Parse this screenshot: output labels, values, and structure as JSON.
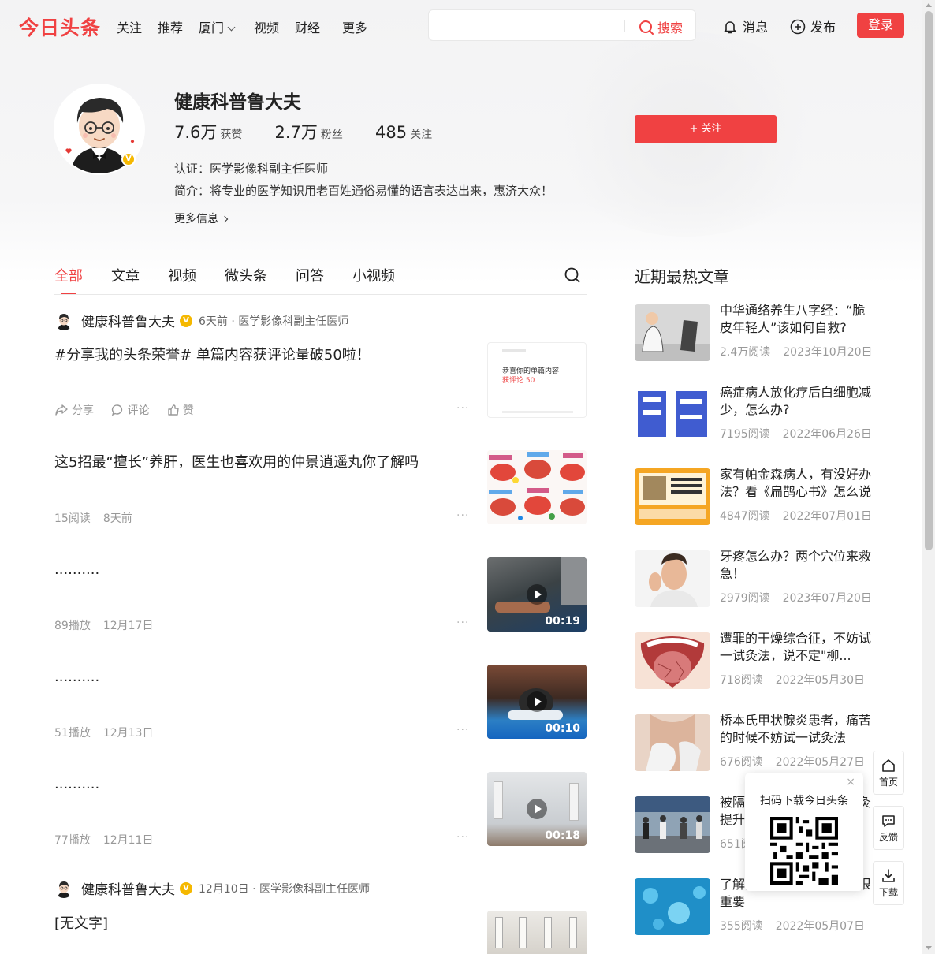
{
  "nav": {
    "logo": "今日头条",
    "links": [
      "关注",
      "推荐",
      "厦门",
      "视频",
      "财经",
      "更多"
    ],
    "search_label": "搜索",
    "messages_label": "消息",
    "publish_label": "发布",
    "login_label": "登录"
  },
  "profile": {
    "name": "健康科普鲁大夫",
    "likes_num": "7.6万",
    "likes_label": "获赞",
    "fans_num": "2.7万",
    "fans_label": "粉丝",
    "follow_num": "485",
    "follow_label": "关注",
    "cert": "认证：医学影像科副主任医师",
    "intro": "简介：将专业的医学知识用老百姓通俗易懂的语言表达出来，惠济大众！",
    "more_info": "更多信息",
    "follow_button": "+ 关注",
    "verify_mark": "V"
  },
  "tabs": [
    "全部",
    "文章",
    "视频",
    "微头条",
    "问答",
    "小视频"
  ],
  "feed": [
    {
      "author": "健康科普鲁大夫",
      "meta": "6天前 · 医学影像科副主任医师",
      "title": "#分享我的头条荣誉# 单篇内容获评论量破50啦！",
      "share": "分享",
      "comment": "评论",
      "like": "赞",
      "thumb_text1": "恭喜你的单篇内容",
      "thumb_text2": "获评论 50"
    },
    {
      "title": "这5招最“擅长”养肝，医生也喜欢用的仲景逍遥丸你了解吗",
      "reads": "15阅读",
      "time": "8天前"
    },
    {
      "title": "..........",
      "plays": "89播放",
      "time": "12月17日",
      "duration": "00:19"
    },
    {
      "title": "..........",
      "plays": "51播放",
      "time": "12月13日",
      "duration": "00:10"
    },
    {
      "title": "..........",
      "plays": "77播放",
      "time": "12月11日",
      "duration": "00:18"
    },
    {
      "author": "健康科普鲁大夫",
      "meta": "12月10日 · 医学影像科副主任医师",
      "title": "[无文字]"
    }
  ],
  "more_dots": "···",
  "hot": {
    "title": "近期最热文章",
    "items": [
      {
        "title": "中华通络养生八字经：“脆皮年轻人”该如何自救?",
        "reads": "2.4万阅读",
        "date": "2023年10月20日"
      },
      {
        "title": "癌症病人放化疗后白细胞减少，怎么办?",
        "reads": "7195阅读",
        "date": "2022年06月26日"
      },
      {
        "title": "家有帕金森病人，有没好办法？看《扁鹊心书》怎么说",
        "reads": "4847阅读",
        "date": "2022年07月01日"
      },
      {
        "title": "牙疼怎么办？两个穴位来救急！",
        "reads": "2979阅读",
        "date": "2023年07月20日"
      },
      {
        "title": "遭罪的干燥综合征，不妨试一试灸法，说不定\"柳...",
        "reads": "718阅读",
        "date": "2022年05月30日"
      },
      {
        "title": "桥本氏甲状腺炎患者，痛苦的时候不妨试一试灸法",
        "reads": "676阅读",
        "date": "2022年05月27日"
      },
      {
        "title": "被隔离在家，可以试试艾灸提升正气浴",
        "reads": "651阅读",
        "date": ""
      },
      {
        "title": "了解疫情后事，做好预防很重要",
        "reads": "355阅读",
        "date": "2022年05月07日"
      }
    ]
  },
  "qr": {
    "text": "扫码下载今日头条",
    "close": "×"
  },
  "side": {
    "home": "首页",
    "feedback": "反馈",
    "download": "下载"
  },
  "colors": {
    "brand_red": "#f04142",
    "verify_gold": "#f5b800"
  }
}
